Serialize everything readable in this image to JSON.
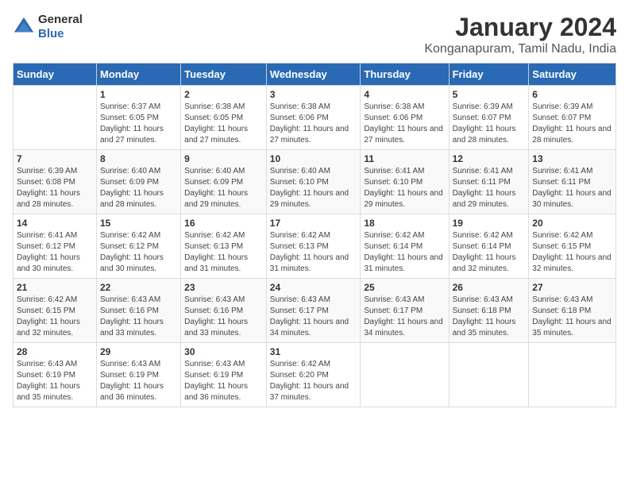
{
  "logo": {
    "text_general": "General",
    "text_blue": "Blue"
  },
  "title": "January 2024",
  "subtitle": "Konganapuram, Tamil Nadu, India",
  "header": {
    "days": [
      "Sunday",
      "Monday",
      "Tuesday",
      "Wednesday",
      "Thursday",
      "Friday",
      "Saturday"
    ]
  },
  "weeks": [
    [
      {
        "num": "",
        "sunrise": "",
        "sunset": "",
        "daylight": ""
      },
      {
        "num": "1",
        "sunrise": "Sunrise: 6:37 AM",
        "sunset": "Sunset: 6:05 PM",
        "daylight": "Daylight: 11 hours and 27 minutes."
      },
      {
        "num": "2",
        "sunrise": "Sunrise: 6:38 AM",
        "sunset": "Sunset: 6:05 PM",
        "daylight": "Daylight: 11 hours and 27 minutes."
      },
      {
        "num": "3",
        "sunrise": "Sunrise: 6:38 AM",
        "sunset": "Sunset: 6:06 PM",
        "daylight": "Daylight: 11 hours and 27 minutes."
      },
      {
        "num": "4",
        "sunrise": "Sunrise: 6:38 AM",
        "sunset": "Sunset: 6:06 PM",
        "daylight": "Daylight: 11 hours and 27 minutes."
      },
      {
        "num": "5",
        "sunrise": "Sunrise: 6:39 AM",
        "sunset": "Sunset: 6:07 PM",
        "daylight": "Daylight: 11 hours and 28 minutes."
      },
      {
        "num": "6",
        "sunrise": "Sunrise: 6:39 AM",
        "sunset": "Sunset: 6:07 PM",
        "daylight": "Daylight: 11 hours and 28 minutes."
      }
    ],
    [
      {
        "num": "7",
        "sunrise": "Sunrise: 6:39 AM",
        "sunset": "Sunset: 6:08 PM",
        "daylight": "Daylight: 11 hours and 28 minutes."
      },
      {
        "num": "8",
        "sunrise": "Sunrise: 6:40 AM",
        "sunset": "Sunset: 6:09 PM",
        "daylight": "Daylight: 11 hours and 28 minutes."
      },
      {
        "num": "9",
        "sunrise": "Sunrise: 6:40 AM",
        "sunset": "Sunset: 6:09 PM",
        "daylight": "Daylight: 11 hours and 29 minutes."
      },
      {
        "num": "10",
        "sunrise": "Sunrise: 6:40 AM",
        "sunset": "Sunset: 6:10 PM",
        "daylight": "Daylight: 11 hours and 29 minutes."
      },
      {
        "num": "11",
        "sunrise": "Sunrise: 6:41 AM",
        "sunset": "Sunset: 6:10 PM",
        "daylight": "Daylight: 11 hours and 29 minutes."
      },
      {
        "num": "12",
        "sunrise": "Sunrise: 6:41 AM",
        "sunset": "Sunset: 6:11 PM",
        "daylight": "Daylight: 11 hours and 29 minutes."
      },
      {
        "num": "13",
        "sunrise": "Sunrise: 6:41 AM",
        "sunset": "Sunset: 6:11 PM",
        "daylight": "Daylight: 11 hours and 30 minutes."
      }
    ],
    [
      {
        "num": "14",
        "sunrise": "Sunrise: 6:41 AM",
        "sunset": "Sunset: 6:12 PM",
        "daylight": "Daylight: 11 hours and 30 minutes."
      },
      {
        "num": "15",
        "sunrise": "Sunrise: 6:42 AM",
        "sunset": "Sunset: 6:12 PM",
        "daylight": "Daylight: 11 hours and 30 minutes."
      },
      {
        "num": "16",
        "sunrise": "Sunrise: 6:42 AM",
        "sunset": "Sunset: 6:13 PM",
        "daylight": "Daylight: 11 hours and 31 minutes."
      },
      {
        "num": "17",
        "sunrise": "Sunrise: 6:42 AM",
        "sunset": "Sunset: 6:13 PM",
        "daylight": "Daylight: 11 hours and 31 minutes."
      },
      {
        "num": "18",
        "sunrise": "Sunrise: 6:42 AM",
        "sunset": "Sunset: 6:14 PM",
        "daylight": "Daylight: 11 hours and 31 minutes."
      },
      {
        "num": "19",
        "sunrise": "Sunrise: 6:42 AM",
        "sunset": "Sunset: 6:14 PM",
        "daylight": "Daylight: 11 hours and 32 minutes."
      },
      {
        "num": "20",
        "sunrise": "Sunrise: 6:42 AM",
        "sunset": "Sunset: 6:15 PM",
        "daylight": "Daylight: 11 hours and 32 minutes."
      }
    ],
    [
      {
        "num": "21",
        "sunrise": "Sunrise: 6:42 AM",
        "sunset": "Sunset: 6:15 PM",
        "daylight": "Daylight: 11 hours and 32 minutes."
      },
      {
        "num": "22",
        "sunrise": "Sunrise: 6:43 AM",
        "sunset": "Sunset: 6:16 PM",
        "daylight": "Daylight: 11 hours and 33 minutes."
      },
      {
        "num": "23",
        "sunrise": "Sunrise: 6:43 AM",
        "sunset": "Sunset: 6:16 PM",
        "daylight": "Daylight: 11 hours and 33 minutes."
      },
      {
        "num": "24",
        "sunrise": "Sunrise: 6:43 AM",
        "sunset": "Sunset: 6:17 PM",
        "daylight": "Daylight: 11 hours and 34 minutes."
      },
      {
        "num": "25",
        "sunrise": "Sunrise: 6:43 AM",
        "sunset": "Sunset: 6:17 PM",
        "daylight": "Daylight: 11 hours and 34 minutes."
      },
      {
        "num": "26",
        "sunrise": "Sunrise: 6:43 AM",
        "sunset": "Sunset: 6:18 PM",
        "daylight": "Daylight: 11 hours and 35 minutes."
      },
      {
        "num": "27",
        "sunrise": "Sunrise: 6:43 AM",
        "sunset": "Sunset: 6:18 PM",
        "daylight": "Daylight: 11 hours and 35 minutes."
      }
    ],
    [
      {
        "num": "28",
        "sunrise": "Sunrise: 6:43 AM",
        "sunset": "Sunset: 6:19 PM",
        "daylight": "Daylight: 11 hours and 35 minutes."
      },
      {
        "num": "29",
        "sunrise": "Sunrise: 6:43 AM",
        "sunset": "Sunset: 6:19 PM",
        "daylight": "Daylight: 11 hours and 36 minutes."
      },
      {
        "num": "30",
        "sunrise": "Sunrise: 6:43 AM",
        "sunset": "Sunset: 6:19 PM",
        "daylight": "Daylight: 11 hours and 36 minutes."
      },
      {
        "num": "31",
        "sunrise": "Sunrise: 6:42 AM",
        "sunset": "Sunset: 6:20 PM",
        "daylight": "Daylight: 11 hours and 37 minutes."
      },
      {
        "num": "",
        "sunrise": "",
        "sunset": "",
        "daylight": ""
      },
      {
        "num": "",
        "sunrise": "",
        "sunset": "",
        "daylight": ""
      },
      {
        "num": "",
        "sunrise": "",
        "sunset": "",
        "daylight": ""
      }
    ]
  ]
}
